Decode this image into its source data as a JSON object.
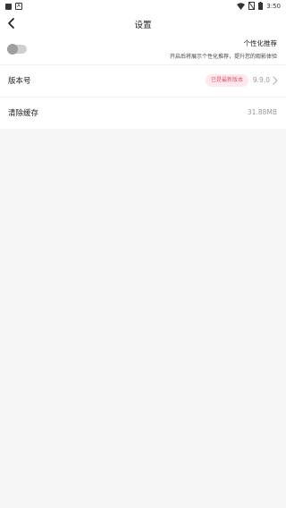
{
  "status_bar": {
    "time": "3:50",
    "left_badge": "A"
  },
  "header": {
    "title": "设置"
  },
  "personalization": {
    "title": "个性化推荐",
    "description": "开启后将展示个性化推荐，提升您的观影体验",
    "enabled": false
  },
  "version": {
    "label": "版本号",
    "badge": "已是最新版本",
    "value": "9.9.0"
  },
  "cache": {
    "label": "清除缓存",
    "value": "31.88MB"
  },
  "colors": {
    "badge_text": "#e0566d",
    "badge_bg": "#fde8ec",
    "page_bg": "#f6f6f6"
  }
}
